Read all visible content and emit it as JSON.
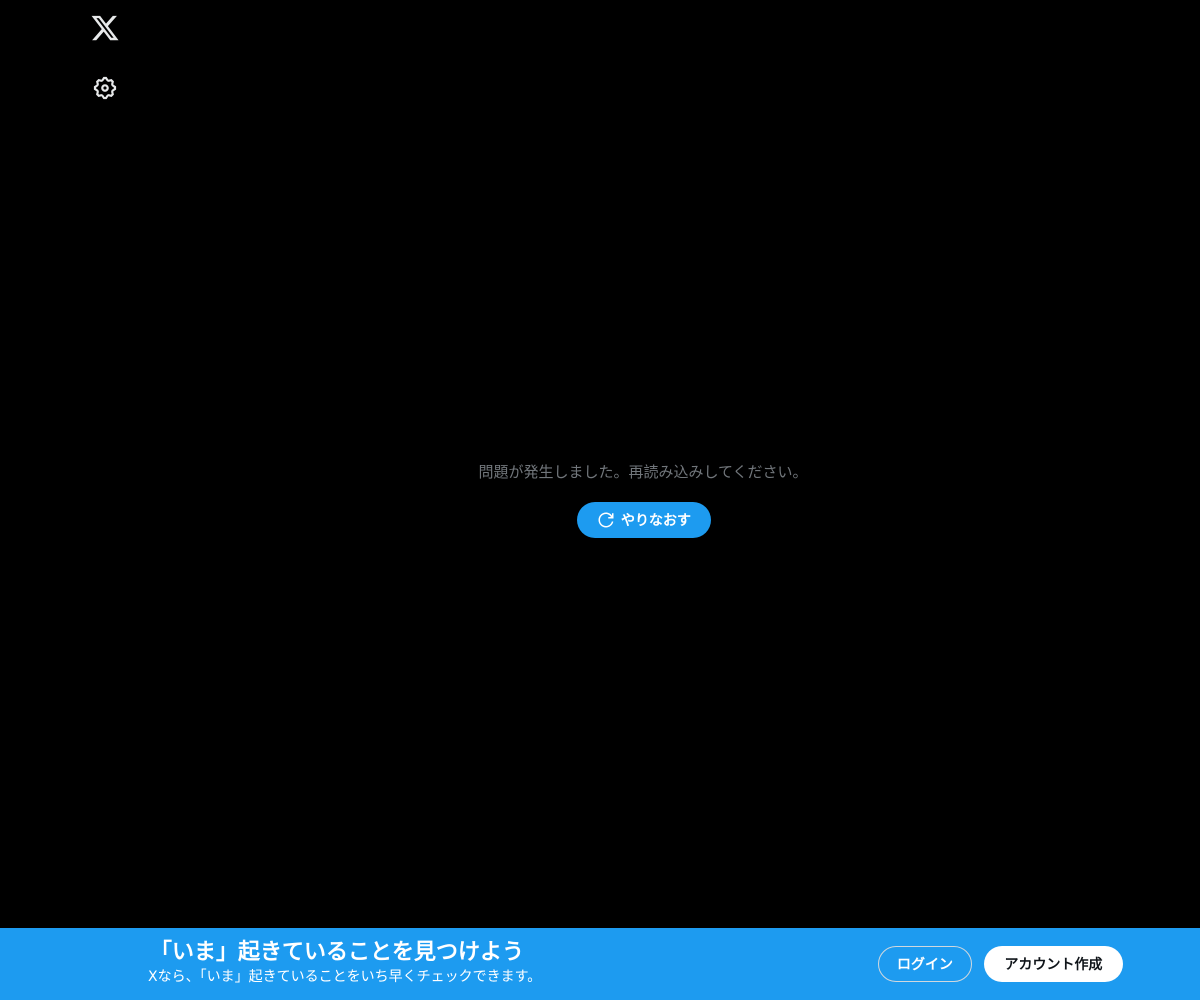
{
  "sidebar": {
    "logo_icon": "x-logo-icon",
    "settings_icon": "gear-icon"
  },
  "main": {
    "error_message": "問題が発生しました。再読み込みしてください。",
    "retry_label": "やりなおす",
    "retry_icon": "refresh-icon"
  },
  "bottom_bar": {
    "title": "「いま」起きていることを見つけよう",
    "subtitle": "Xなら、「いま」起きていることをいち早くチェックできます。",
    "login_label": "ログイン",
    "signup_label": "アカウント作成"
  },
  "colors": {
    "background": "#000000",
    "accent": "#1d9bf0",
    "muted_text": "#71767b",
    "white": "#ffffff"
  }
}
